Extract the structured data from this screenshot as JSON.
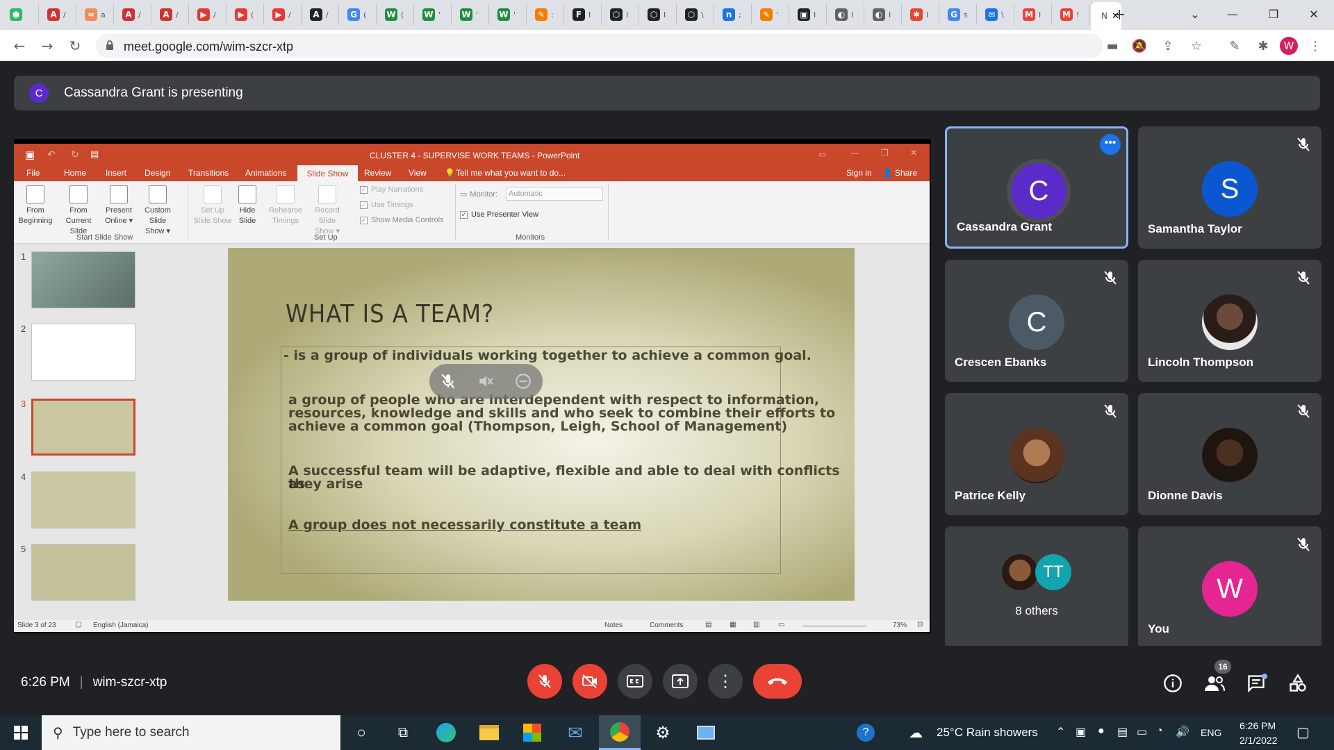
{
  "browser": {
    "tabs": [
      {
        "icon": "evernote-icon",
        "color": "#2dbe60",
        "glyph": "⬢",
        "text": ""
      },
      {
        "icon": "acrobat-icon",
        "color": "#d32f2f",
        "glyph": "A",
        "text": "/"
      },
      {
        "icon": "ptab-icon",
        "color": "#f08c5a",
        "glyph": "≈",
        "text": "a"
      },
      {
        "icon": "acrobat-icon",
        "color": "#d32f2f",
        "glyph": "A",
        "text": "/"
      },
      {
        "icon": "acrobat-icon",
        "color": "#d32f2f",
        "glyph": "A",
        "text": "/"
      },
      {
        "icon": "youtube-icon",
        "color": "#e53935",
        "glyph": "▶",
        "text": "/"
      },
      {
        "icon": "youtube-icon",
        "color": "#e53935",
        "glyph": "▶",
        "text": "("
      },
      {
        "icon": "youtube-icon",
        "color": "#e53935",
        "glyph": "▶",
        "text": "/"
      },
      {
        "icon": "a-icon",
        "color": "#222222",
        "glyph": "A",
        "text": "/"
      },
      {
        "icon": "google-icon",
        "color": "#4285f4",
        "glyph": "G",
        "text": "("
      },
      {
        "icon": "w-icon",
        "color": "#1e8e3e",
        "glyph": "W",
        "text": "("
      },
      {
        "icon": "w-icon",
        "color": "#1e8e3e",
        "glyph": "W",
        "text": "'"
      },
      {
        "icon": "w-icon",
        "color": "#1e8e3e",
        "glyph": "W",
        "text": "'"
      },
      {
        "icon": "w-icon",
        "color": "#1e8e3e",
        "glyph": "W",
        "text": "'"
      },
      {
        "icon": "pen-icon",
        "color": "#f57c00",
        "glyph": "✎",
        "text": ":"
      },
      {
        "icon": "f-icon",
        "color": "#222222",
        "glyph": "F",
        "text": "I"
      },
      {
        "icon": "codepen-icon",
        "color": "#222222",
        "glyph": "⬡",
        "text": "I"
      },
      {
        "icon": "codepen-icon",
        "color": "#222222",
        "glyph": "⬡",
        "text": "I"
      },
      {
        "icon": "codepen-icon",
        "color": "#222222",
        "glyph": "⬡",
        "text": "\\"
      },
      {
        "icon": "n-icon",
        "color": "#1a73e8",
        "glyph": "n",
        "text": ";"
      },
      {
        "icon": "pen-icon",
        "color": "#f57c00",
        "glyph": "✎",
        "text": "'"
      },
      {
        "icon": "bag-icon",
        "color": "#222222",
        "glyph": "▣",
        "text": "I"
      },
      {
        "icon": "globe-icon",
        "color": "#5f6368",
        "glyph": "◐",
        "text": "I"
      },
      {
        "icon": "globe-icon",
        "color": "#5f6368",
        "glyph": "◐",
        "text": "I"
      },
      {
        "icon": "puzzle-icon",
        "color": "#ea4335",
        "glyph": "✱",
        "text": "I"
      },
      {
        "icon": "google-icon",
        "color": "#4285f4",
        "glyph": "G",
        "text": "s"
      },
      {
        "icon": "mail-icon",
        "color": "#1a73e8",
        "glyph": "✉",
        "text": "\\"
      },
      {
        "icon": "gmail-icon",
        "color": "#ea4335",
        "glyph": "M",
        "text": "I"
      },
      {
        "icon": "gmail-icon",
        "color": "#ea4335",
        "glyph": "M",
        "text": "!"
      }
    ],
    "active_tab_text": "N",
    "url": "meet.google.com/wim-szcr-xtp",
    "profile_initial": "W"
  },
  "meet": {
    "presenter_initial": "C",
    "presenting_text": "Cassandra Grant is presenting",
    "time": "6:26 PM",
    "separator": "|",
    "meeting_code": "wim-szcr-xtp",
    "people_badge": "16",
    "participants": [
      {
        "name": "Cassandra Grant",
        "initial": "C",
        "color": "#5b2bc9",
        "type": "initial"
      },
      {
        "name": "Samantha Taylor",
        "initial": "S",
        "color": "#0b57d0",
        "type": "initial"
      },
      {
        "name": "Crescen Ebanks",
        "initial": "C",
        "color": "#4b5a66",
        "type": "initial"
      },
      {
        "name": "Lincoln Thompson",
        "type": "photo"
      },
      {
        "name": "Patrice Kelly",
        "type": "photo"
      },
      {
        "name": "Dionne Davis",
        "type": "photo"
      }
    ],
    "others_label": "8 others",
    "others_initials": "TT",
    "you_label": "You",
    "you_initial": "W"
  },
  "powerpoint": {
    "window_title": "CLUSTER 4 - SUPERVISE WORK TEAMS - PowerPoint",
    "tabs": [
      "File",
      "Home",
      "Insert",
      "Design",
      "Transitions",
      "Animations",
      "Slide Show",
      "Review",
      "View"
    ],
    "tell_me": "Tell me what you want to do...",
    "sign_in": "Sign in",
    "share": "Share",
    "ribbon": {
      "from_beginning": [
        "From",
        "Beginning"
      ],
      "from_current": [
        "From",
        "Current Slide"
      ],
      "present_online": [
        "Present",
        "Online ▾"
      ],
      "custom_show": [
        "Custom Slide",
        "Show ▾"
      ],
      "set_up": [
        "Set Up",
        "Slide Show"
      ],
      "hide_slide": [
        "Hide",
        "Slide"
      ],
      "rehearse": [
        "Rehearse",
        "Timings"
      ],
      "record": [
        "Record Slide",
        "Show ▾"
      ],
      "play_narrations": "Play Narrations",
      "use_timings": "Use Timings",
      "show_media": "Show Media Controls",
      "monitor_label": "Monitor:",
      "monitor_value": "Automatic",
      "presenter_view": "Use Presenter View",
      "group_start": "Start Slide Show",
      "group_setup": "Set Up",
      "group_monitors": "Monitors"
    },
    "thumb_numbers": [
      "1",
      "2",
      "3",
      "4",
      "5"
    ],
    "slide_title": "WHAT IS A TEAM?",
    "slide_lines": [
      "- is a group of individuals working together to achieve a common goal.",
      "a group of people who are interdependent with respect to information,",
      "resources, knowledge and skills and who seek to combine their efforts to",
      "achieve a common goal (Thompson, Leigh, School of Management)",
      "A successful team will be adaptive, flexible and able to deal with conflicts as",
      "they arise",
      "A group does not necessarily constitute a team"
    ],
    "status": {
      "slide_of": "Slide 3 of 23",
      "language": "English (Jamaica)",
      "notes": "Notes",
      "comments": "Comments",
      "zoom": "73%"
    }
  },
  "taskbar": {
    "search_placeholder": "Type here to search",
    "weather": "25°C  Rain showers",
    "lang": "ENG",
    "time": "6:26 PM",
    "date": "2/1/2022"
  }
}
